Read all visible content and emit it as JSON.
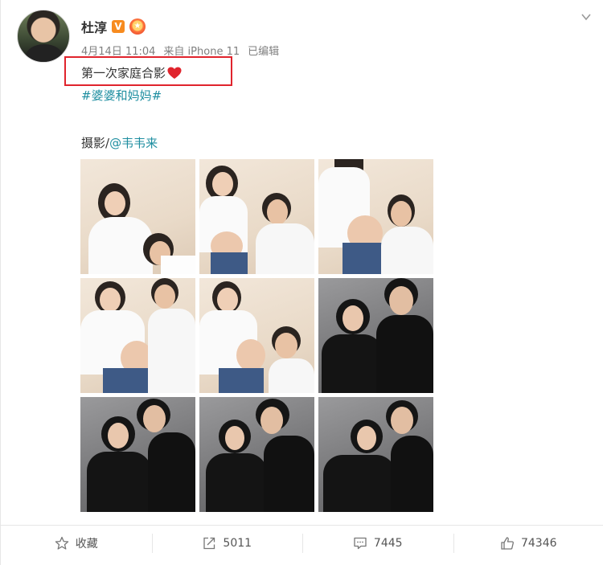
{
  "author": {
    "name": "杜淳",
    "verified_badge": "V"
  },
  "post": {
    "meta": {
      "date": "4月14日 11:04",
      "source": "来自 iPhone 11",
      "edited": "已编辑"
    },
    "text": "第一次家庭合影",
    "topic": "#婆婆和妈妈#",
    "credit_prefix": "摄影/",
    "credit_mention": "@韦韦来"
  },
  "photos": [
    {
      "tone": "light"
    },
    {
      "tone": "light"
    },
    {
      "tone": "light"
    },
    {
      "tone": "light"
    },
    {
      "tone": "light"
    },
    {
      "tone": "dark"
    },
    {
      "tone": "dark"
    },
    {
      "tone": "dark"
    },
    {
      "tone": "dark"
    }
  ],
  "actions": [
    {
      "id": "favorite",
      "label": "收藏",
      "icon": "star-icon"
    },
    {
      "id": "repost",
      "label": "5011",
      "icon": "share-icon"
    },
    {
      "id": "comment",
      "label": "7445",
      "icon": "comment-icon"
    },
    {
      "id": "like",
      "label": "74346",
      "icon": "thumbs-up-icon"
    }
  ],
  "colors": {
    "link": "#1e8ea0",
    "highlight": "#e0242d",
    "badge": "#f78b1f",
    "heart": "#e0242d"
  }
}
